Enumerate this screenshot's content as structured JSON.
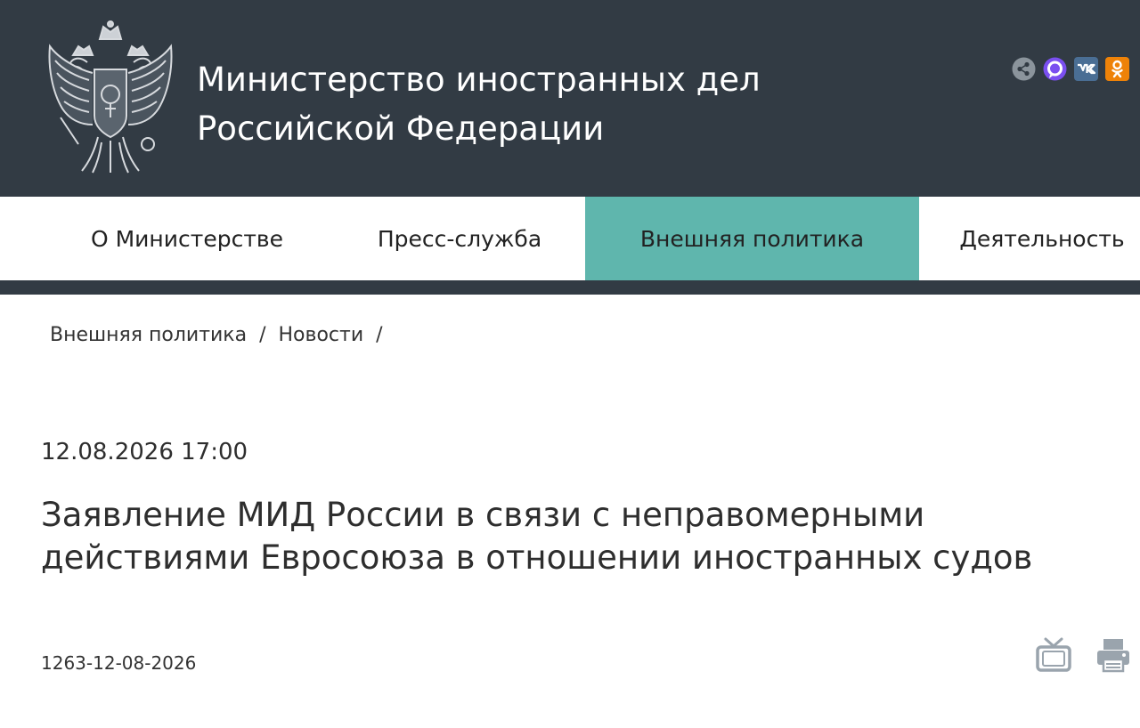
{
  "header": {
    "title_line1": "Министерство иностранных дел",
    "title_line2": "Российской Федерации",
    "bg_color": "#323b44"
  },
  "social": [
    {
      "name": "share",
      "icon": "share-icon"
    },
    {
      "name": "channel",
      "icon": "speech-bubble-icon"
    },
    {
      "name": "vk",
      "label": "vk",
      "icon": "vk-icon"
    },
    {
      "name": "ok",
      "icon": "odnoklassniki-icon"
    }
  ],
  "nav": {
    "items": [
      {
        "label": "О Министерстве"
      },
      {
        "label": "Пресс-служба"
      },
      {
        "label": "Внешняя политика",
        "active": true
      },
      {
        "label": "Деятельность"
      }
    ],
    "active_color": "#5fb6ad"
  },
  "breadcrumb": {
    "items": [
      "Внешняя политика",
      "Новости"
    ],
    "separator": "/"
  },
  "article": {
    "date": "12.08.2026 17:00",
    "title_line1": "Заявление МИД России в связи с неправомерными",
    "title_line2": "действиями Евросоюза в отношении иностранных судов",
    "doc_number": "1263-12-08-2026"
  },
  "tools": [
    {
      "name": "tv",
      "icon": "tv-icon"
    },
    {
      "name": "print",
      "icon": "printer-icon"
    }
  ]
}
